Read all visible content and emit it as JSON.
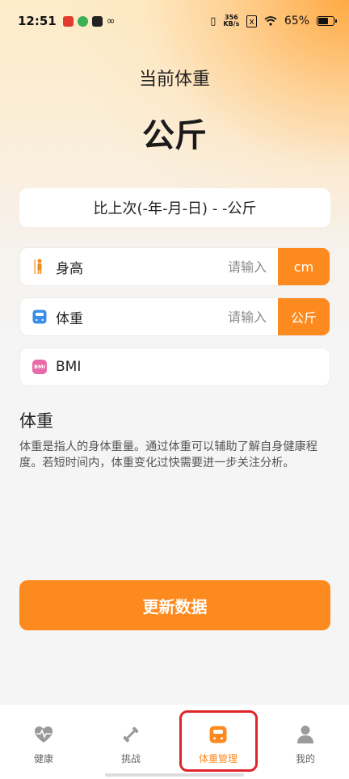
{
  "status_bar": {
    "time": "12:51",
    "network_speed_top": "356",
    "network_speed_bottom": "KB/s",
    "battery": "65%"
  },
  "header": {
    "title": "当前体重",
    "unit": "公斤"
  },
  "compare": {
    "text": "比上次(-年-月-日) - -公斤"
  },
  "fields": {
    "height": {
      "label": "身高",
      "placeholder": "请输入",
      "unit": "cm"
    },
    "weight": {
      "label": "体重",
      "placeholder": "请输入",
      "unit": "公斤"
    },
    "bmi": {
      "label": "BMI",
      "icon_text": "BMI"
    }
  },
  "info": {
    "title": "体重",
    "description": "体重是指人的身体重量。通过体重可以辅助了解自身健康程度。若短时间内，体重变化过快需要进一步关注分析。"
  },
  "actions": {
    "update_label": "更新数据"
  },
  "tabbar": {
    "items": [
      {
        "label": "健康",
        "icon": "heart-pulse-icon"
      },
      {
        "label": "挑战",
        "icon": "dumbbell-icon"
      },
      {
        "label": "体重管理",
        "icon": "scale-icon"
      },
      {
        "label": "我的",
        "icon": "person-icon"
      }
    ],
    "active_index": 2
  },
  "colors": {
    "accent": "#fd8a1e",
    "highlight": "#e0242c",
    "height_icon": "#f08a1c",
    "weight_icon": "#3a8ee8",
    "bmi_icon": "#e86aa8"
  }
}
